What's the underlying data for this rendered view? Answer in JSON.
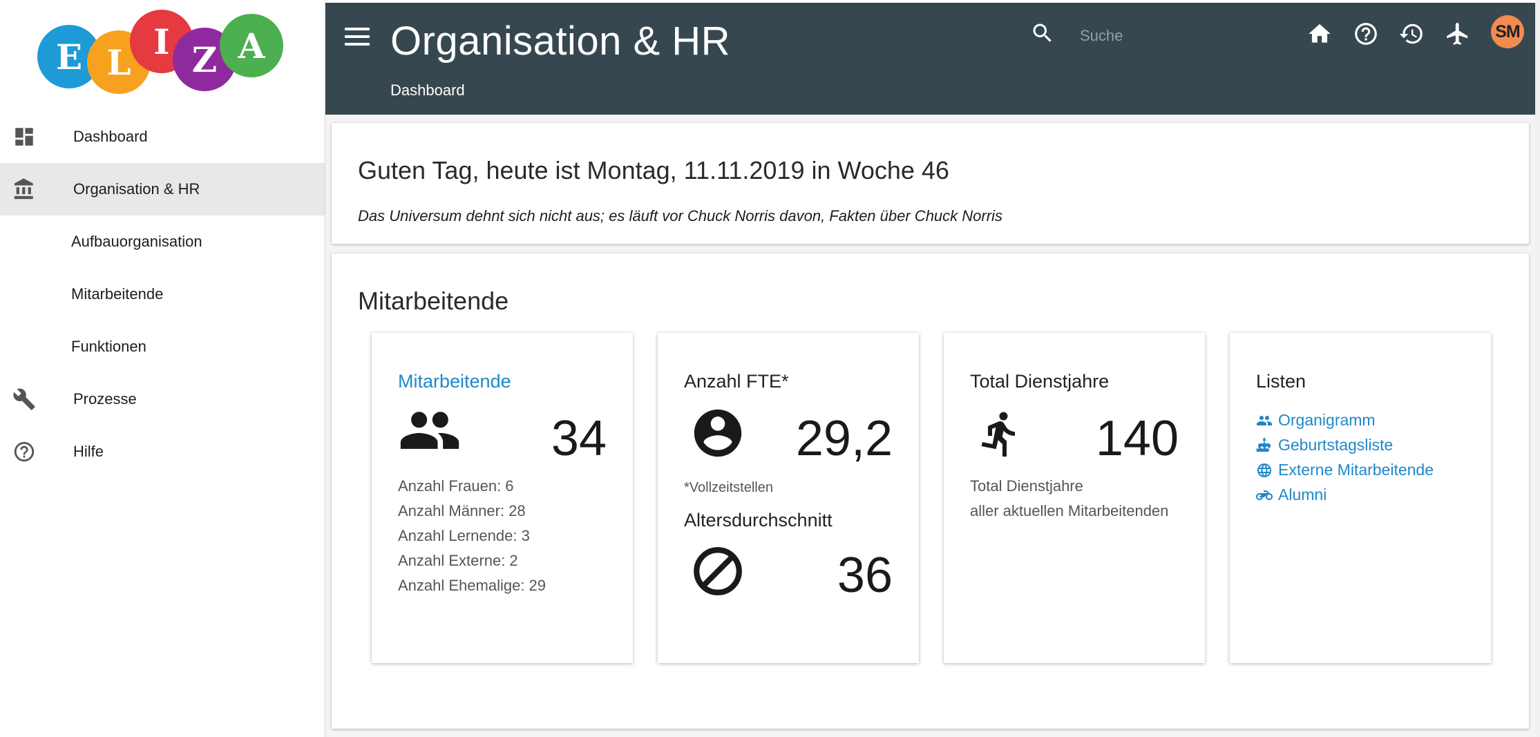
{
  "logo": {
    "letters": [
      "E",
      "L",
      "I",
      "Z",
      "A"
    ]
  },
  "sidebar": {
    "items": [
      {
        "label": "Dashboard",
        "icon": "dashboard-icon"
      },
      {
        "label": "Organisation & HR",
        "icon": "bank-icon",
        "active": true
      },
      {
        "label": "Aufbauorganisation"
      },
      {
        "label": "Mitarbeitende"
      },
      {
        "label": "Funktionen"
      },
      {
        "label": "Prozesse",
        "icon": "wrench-icon"
      },
      {
        "label": "Hilfe",
        "icon": "help-circle-icon"
      }
    ]
  },
  "header": {
    "title": "Organisation & HR",
    "breadcrumb": "Dashboard",
    "search_placeholder": "Suche",
    "avatar_initials": "SM",
    "icons": [
      "home-icon",
      "help-icon",
      "history-icon",
      "airplane-icon"
    ],
    "bg_color": "#37474f"
  },
  "greeting": {
    "title": "Guten Tag, heute ist Montag, 11.11.2019 in Woche 46",
    "quote": "Das Universum dehnt sich nicht aus; es läuft vor Chuck Norris davon, Fakten über Chuck Norris"
  },
  "staff": {
    "section_title": "Mitarbeitende",
    "employees": {
      "title": "Mitarbeitende",
      "count": "34",
      "details": [
        "Anzahl Frauen: 6",
        "Anzahl Männer: 28",
        "Anzahl Lernende: 3",
        "Anzahl Externe: 2",
        "Anzahl Ehemalige: 29"
      ]
    },
    "fte": {
      "title": "Anzahl FTE*",
      "value": "29,2",
      "note": "*Vollzeitstellen",
      "age_title": "Altersdurchschnitt",
      "age_value": "36"
    },
    "service": {
      "title": "Total Dienstjahre",
      "value": "140",
      "desc1": "Total Dienstjahre",
      "desc2": "aller aktuellen Mitarbeitenden"
    },
    "lists": {
      "title": "Listen",
      "links": [
        "Organigramm",
        "Geburtstagsliste",
        "Externe Mitarbeitende",
        "Alumni"
      ]
    }
  },
  "colors": {
    "accent": "#1e88c8",
    "avatar": "#f28b50",
    "active_nav": "#e8e8e8"
  }
}
